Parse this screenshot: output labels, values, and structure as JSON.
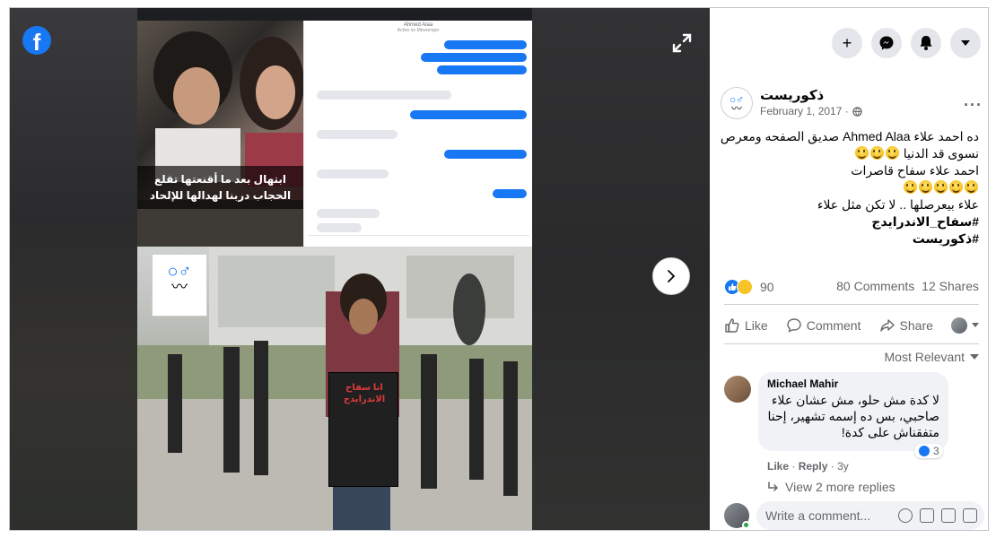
{
  "viewer": {
    "photo_caption": "ابتهال بعد ما أقنعتها تقلع الحجاب دربنا لهدالها للإلحاد",
    "chat_title": "Ahmed Alaa",
    "chat_subtitle": "Active on Messenger",
    "poster_text": "انا سفاح الاندرايدج"
  },
  "page": {
    "name": "ذكوريست",
    "date": "February 1, 2017 ·",
    "logo_symbol": "○♂"
  },
  "post": {
    "line1": "ده احمد علاء Ahmed Alaa صديق الصفحه ومعرص",
    "line2": "نسوى قد الدنيا",
    "line3": "احمد علاء سفاح قاصرات",
    "line5": "علاء بيعرصلها .. لا تكن مثل علاء",
    "hashtag1": "#سفاح_الاندرايدج",
    "hashtag2": "#ذكوريست"
  },
  "stats": {
    "reactions_count": "90",
    "comments": "80 Comments",
    "shares": "12 Shares"
  },
  "actions": {
    "like": "Like",
    "comment": "Comment",
    "share": "Share"
  },
  "comments_section": {
    "sort_label": "Most Relevant",
    "comment": {
      "author": "Michael Mahir",
      "text": "لا كدة مش حلو، مش عشان علاء صاحبي، بس ده إسمه تشهير، إحنا متفقناش على كدة!",
      "likes": "3",
      "like_action": "Like",
      "reply_action": "Reply",
      "age": "3y"
    },
    "view_replies": "View 2 more replies"
  },
  "composer": {
    "placeholder": "Write a comment..."
  },
  "colors": {
    "brand": "#1877f2",
    "text_secondary": "#65676b",
    "bubble_bg": "#f0f2f5"
  }
}
